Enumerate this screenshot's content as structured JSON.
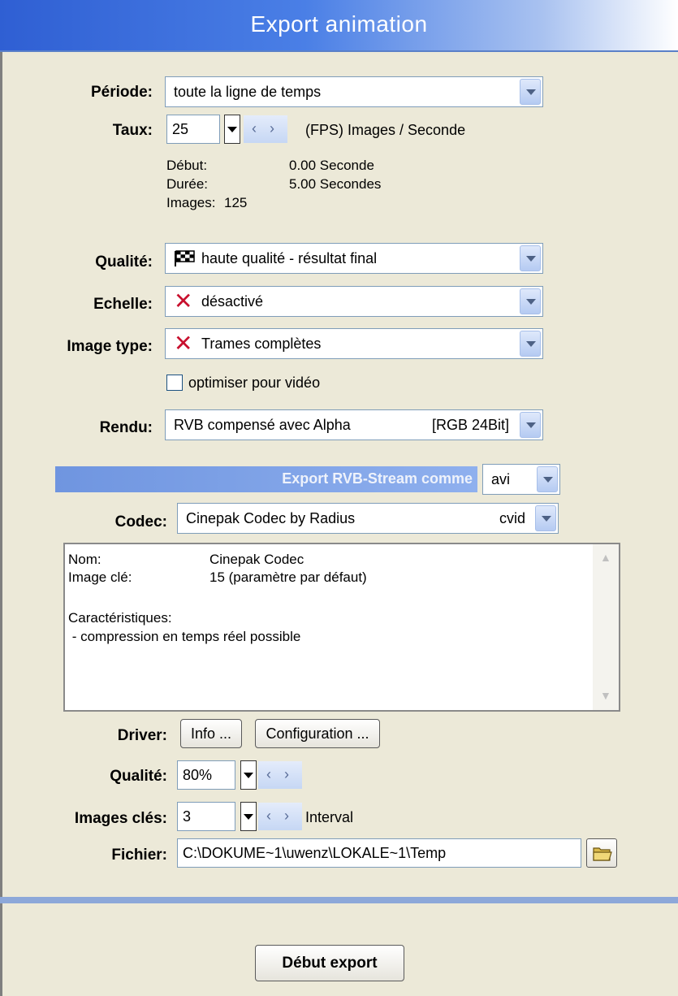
{
  "window": {
    "title": "Export animation"
  },
  "periode": {
    "label": "Période:",
    "value": "toute la ligne de temps"
  },
  "taux": {
    "label": "Taux:",
    "value": "25",
    "unit": "(FPS) Images / Seconde"
  },
  "timing": {
    "debut_label": "Début:",
    "debut_value": "0.00 Seconde",
    "duree_label": "Durée:",
    "duree_value": "5.00 Secondes",
    "images_label": "Images:",
    "images_value": "125"
  },
  "qualite": {
    "label": "Qualité:",
    "value": "haute qualité - résultat final"
  },
  "echelle": {
    "label": "Echelle:",
    "value": "désactivé"
  },
  "image_type": {
    "label": "Image type:",
    "value": "Trames complètes"
  },
  "optimise": {
    "label": "optimiser pour vidéo",
    "checked": false
  },
  "rendu": {
    "label": "Rendu:",
    "value": "RVB compensé avec Alpha",
    "format": "[RGB 24Bit]"
  },
  "stream": {
    "label": "Export RVB-Stream comme",
    "value": "avi"
  },
  "codec": {
    "label": "Codec:",
    "value": "Cinepak Codec by Radius",
    "code": "cvid",
    "info": {
      "nom_label": "Nom:",
      "nom_value": "Cinepak Codec",
      "key_label": "Image clé:",
      "key_value": "15 (paramètre par défaut)",
      "char_label": "Caractéristiques:",
      "char_item": " - compression en temps réel possible"
    }
  },
  "driver": {
    "label": "Driver:",
    "info_button": "Info ...",
    "config_button": "Configuration ..."
  },
  "driver_qualite": {
    "label": "Qualité:",
    "value": "80%"
  },
  "images_cles": {
    "label": "Images clés:",
    "value": "3",
    "suffix": "Interval"
  },
  "fichier": {
    "label": "Fichier:",
    "value": "C:\\DOKUME~1\\uwenz\\LOKALE~1\\Temp"
  },
  "footer": {
    "start_button": "Début export"
  },
  "colors": {
    "header_blue": "#2f5fd3",
    "accent_x": "#c8102e",
    "background": "#ece9d8"
  }
}
